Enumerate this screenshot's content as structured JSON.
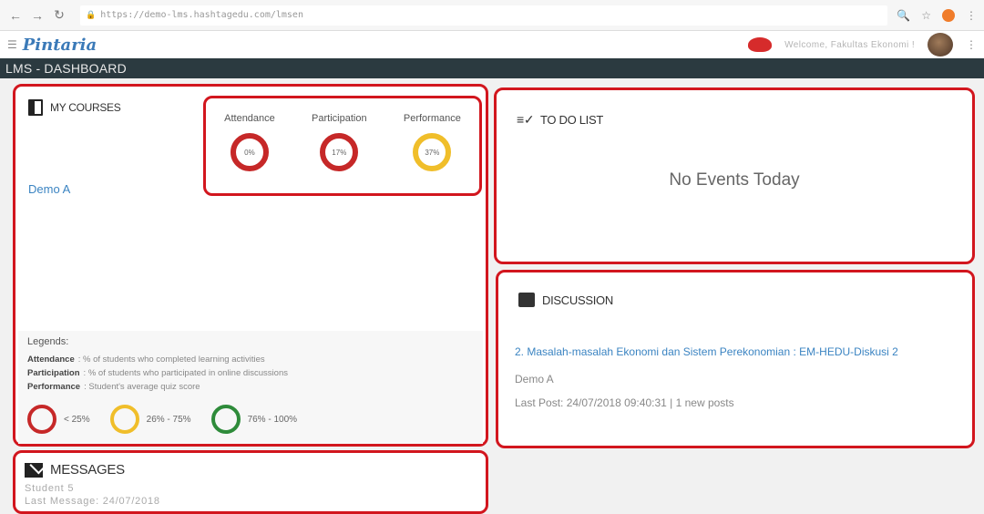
{
  "browser": {
    "url": "https://demo-lms.hashtagedu.com/lmsen"
  },
  "header": {
    "logo": "Pintaria",
    "welcome": "Welcome, Fakultas Ekonomi !"
  },
  "title_bar": "LMS - DASHBOARD",
  "courses": {
    "title": "MY COURSES",
    "course_link": "Demo A",
    "metrics": [
      {
        "label": "Attendance",
        "value": "0%",
        "color": "red"
      },
      {
        "label": "Participation",
        "value": "17%",
        "color": "red"
      },
      {
        "label": "Performance",
        "value": "37%",
        "color": "yellow"
      }
    ],
    "legends": {
      "title": "Legends:",
      "attendance_key": "Attendance",
      "attendance_text": ": % of students who completed learning activities",
      "participation_key": "Participation",
      "participation_text": ": % of students who participated in online discussions",
      "performance_key": "Performance",
      "performance_text": ": Student's average quiz score",
      "scale": [
        "< 25%",
        "26% - 75%",
        "76% - 100%"
      ]
    }
  },
  "messages": {
    "title": "MESSAGES",
    "sender": "Student 5",
    "last": "Last Message: 24/07/2018"
  },
  "todo": {
    "title": "TO DO LIST",
    "empty": "No Events Today"
  },
  "discussion": {
    "title": "DISCUSSION",
    "link": "2. Masalah-masalah Ekonomi dan Sistem Perekonomian : EM-HEDU-Diskusi 2",
    "course": "Demo A",
    "last_post": "Last Post: 24/07/2018 09:40:31 | 1 new posts"
  },
  "colors": {
    "red": "#c62828",
    "yellow": "#f0be2a",
    "green": "#2e8b3a",
    "title_bar": "#2b3a40"
  }
}
